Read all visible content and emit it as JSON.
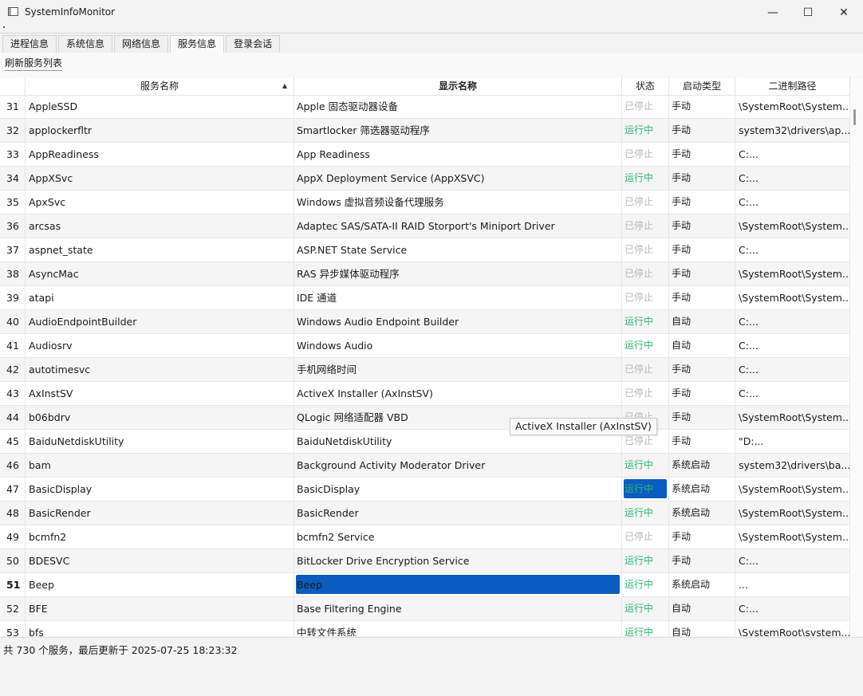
{
  "window": {
    "title": "SystemInfoMonitor",
    "minimize": "—",
    "maximize": "☐",
    "close": "✕"
  },
  "tabs": [
    "进程信息",
    "系统信息",
    "网络信息",
    "服务信息",
    "登录会话"
  ],
  "active_tab": "服务信息",
  "toolbar": {
    "refresh_label": "刷新服务列表"
  },
  "table": {
    "headers": {
      "name": "服务名称",
      "display": "显示名称",
      "status": "状态",
      "start": "启动类型",
      "path": "二进制路径"
    },
    "sort_indicator": "▲",
    "rows": [
      {
        "n": "31",
        "name": "AppleSSD",
        "display": "Apple 固态驱动器设备",
        "status": "已停止",
        "start": "手动",
        "path": "\\SystemRoot\\System..."
      },
      {
        "n": "32",
        "name": "applockerfltr",
        "display": "Smartlocker 筛选器驱动程序",
        "status": "运行中",
        "start": "手动",
        "path": "system32\\drivers\\ap..."
      },
      {
        "n": "33",
        "name": "AppReadiness",
        "display": "App Readiness",
        "status": "已停止",
        "start": "手动",
        "path": "C:..."
      },
      {
        "n": "34",
        "name": "AppXSvc",
        "display": "AppX Deployment Service (AppXSVC)",
        "status": "运行中",
        "start": "手动",
        "path": "C:..."
      },
      {
        "n": "35",
        "name": "ApxSvc",
        "display": "Windows 虚拟音频设备代理服务",
        "status": "已停止",
        "start": "手动",
        "path": "C:..."
      },
      {
        "n": "36",
        "name": "arcsas",
        "display": "Adaptec SAS/SATA-II RAID Storport's Miniport Driver",
        "status": "已停止",
        "start": "手动",
        "path": "\\SystemRoot\\System..."
      },
      {
        "n": "37",
        "name": "aspnet_state",
        "display": "ASP.NET State Service",
        "status": "已停止",
        "start": "手动",
        "path": "C:..."
      },
      {
        "n": "38",
        "name": "AsyncMac",
        "display": "RAS 异步媒体驱动程序",
        "status": "已停止",
        "start": "手动",
        "path": "\\SystemRoot\\System..."
      },
      {
        "n": "39",
        "name": "atapi",
        "display": "IDE 通道",
        "status": "已停止",
        "start": "手动",
        "path": "\\SystemRoot\\System..."
      },
      {
        "n": "40",
        "name": "AudioEndpointBuilder",
        "display": "Windows Audio Endpoint Builder",
        "status": "运行中",
        "start": "自动",
        "path": "C:..."
      },
      {
        "n": "41",
        "name": "Audiosrv",
        "display": "Windows Audio",
        "status": "运行中",
        "start": "自动",
        "path": "C:..."
      },
      {
        "n": "42",
        "name": "autotimesvc",
        "display": "手机网络时间",
        "status": "已停止",
        "start": "手动",
        "path": "C:..."
      },
      {
        "n": "43",
        "name": "AxInstSV",
        "display": "ActiveX Installer (AxInstSV)",
        "status": "已停止",
        "start": "手动",
        "path": "C:..."
      },
      {
        "n": "44",
        "name": "b06bdrv",
        "display": "QLogic 网络适配器 VBD",
        "status": "已停止",
        "start": "手动",
        "path": "\\SystemRoot\\System..."
      },
      {
        "n": "45",
        "name": "BaiduNetdiskUtility",
        "display": "BaiduNetdiskUtility",
        "status": "已停止",
        "start": "手动",
        "path": "\"D:..."
      },
      {
        "n": "46",
        "name": "bam",
        "display": "Background Activity Moderator Driver",
        "status": "运行中",
        "start": "系统启动",
        "path": "system32\\drivers\\ba..."
      },
      {
        "n": "47",
        "name": "BasicDisplay",
        "display": "BasicDisplay",
        "status": "运行中",
        "start": "系统启动",
        "path": "\\SystemRoot\\System..."
      },
      {
        "n": "48",
        "name": "BasicRender",
        "display": "BasicRender",
        "status": "运行中",
        "start": "系统启动",
        "path": "\\SystemRoot\\System..."
      },
      {
        "n": "49",
        "name": "bcmfn2",
        "display": "bcmfn2 Service",
        "status": "已停止",
        "start": "手动",
        "path": "\\SystemRoot\\System..."
      },
      {
        "n": "50",
        "name": "BDESVC",
        "display": "BitLocker Drive Encryption Service",
        "status": "运行中",
        "start": "手动",
        "path": "C:..."
      },
      {
        "n": "51",
        "name": "Beep",
        "display": "Beep",
        "status": "运行中",
        "start": "系统启动",
        "path": "..."
      },
      {
        "n": "52",
        "name": "BFE",
        "display": "Base Filtering Engine",
        "status": "运行中",
        "start": "自动",
        "path": "C:..."
      },
      {
        "n": "53",
        "name": "bfs",
        "display": "中转文件系统",
        "status": "运行中",
        "start": "自动",
        "path": "\\SystemRoot\\system..."
      }
    ]
  },
  "tooltip": "ActiveX Installer (AxInstSV)",
  "status_bar": "共 730 个服务，最后更新于 2025-07-25 18:23:32",
  "colors": {
    "running": "#2cb673",
    "stopped": "#b8b8b8",
    "selection": "#0a5cc1"
  }
}
